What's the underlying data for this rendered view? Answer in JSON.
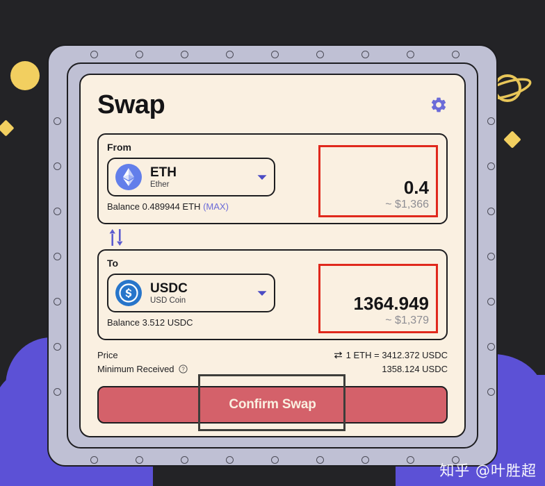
{
  "app": {
    "title": "Swap",
    "settings_icon": "gear-icon"
  },
  "from": {
    "label": "From",
    "token_symbol": "ETH",
    "token_name": "Ether",
    "token_icon": "ethereum-icon",
    "amount": "0.4",
    "amount_usd": "~ $1,366",
    "balance_text": "Balance 0.489944 ETH",
    "max_label": "(MAX)"
  },
  "swap_direction": {
    "icon": "swap-vertical-arrows-icon"
  },
  "to": {
    "label": "To",
    "token_symbol": "USDC",
    "token_name": "USD Coin",
    "token_icon": "usdc-icon",
    "amount": "1364.949",
    "amount_usd": "~ $1,379",
    "balance_text": "Balance 3.512 USDC"
  },
  "info": {
    "price_label": "Price",
    "price_value": "1 ETH = 3412.372 USDC",
    "price_swap_icon": "swap-horizontal-icon",
    "minimum_received_label": "Minimum Received",
    "minimum_received_help_icon": "question-mark-icon",
    "minimum_received_value": "1358.124 USDC"
  },
  "actions": {
    "confirm_label": "Confirm Swap"
  },
  "watermark": {
    "text": "知乎 @叶胜超"
  },
  "colors": {
    "background": "#232326",
    "frame": "#bfc0d4",
    "card": "#faf0e1",
    "accent_purple": "#6b6bd8",
    "confirm_red": "#d4616a",
    "annotation_red": "#e0281c",
    "annotation_dark": "#3d3d3a",
    "decor_yellow": "#f2cf60",
    "decor_purple": "#5c51d6"
  }
}
